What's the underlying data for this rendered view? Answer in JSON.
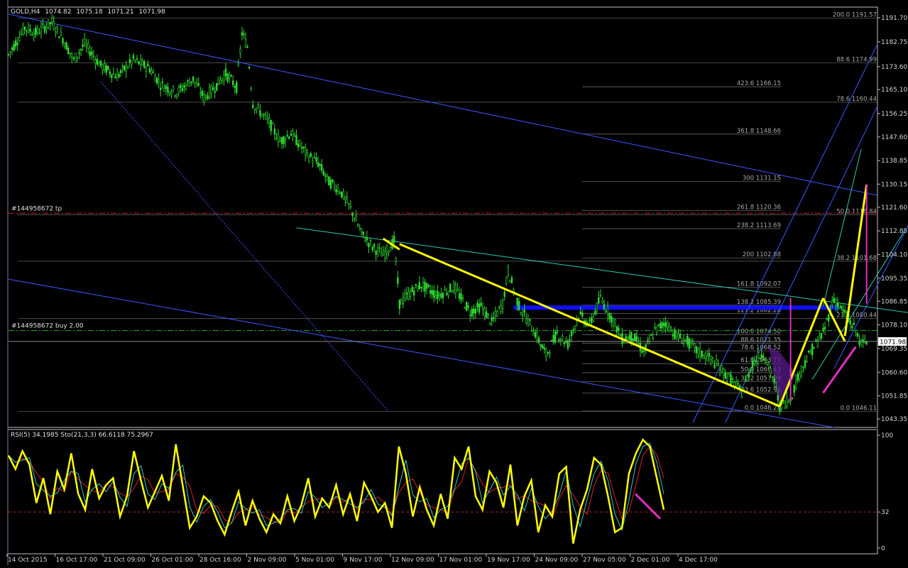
{
  "chart_data": {
    "type": "candlestick",
    "title": "GOLD,H4",
    "ohlc": {
      "open": "1074.82",
      "high": "1075.18",
      "low": "1071.21",
      "close": "1071.98"
    },
    "current_price": "1071.98",
    "price_axis": {
      "ylim": [
        1040.2,
        1195.6
      ],
      "ticks": [
        "1191.70",
        "1182.75",
        "1173.60",
        "1165.10",
        "1156.25",
        "1147.60",
        "1138.85",
        "1130.15",
        "1121.60",
        "1112.85",
        "1104.10",
        "1095.35",
        "1086.85",
        "1078.10",
        "1069.35",
        "1060.60",
        "1051.85",
        "1043.35"
      ]
    },
    "time_axis": {
      "labels": [
        "14 Oct 2015",
        "16 Oct 17:00",
        "21 Oct 09:00",
        "26 Oct 01:00",
        "28 Oct 16:00",
        "2 Nov 09:00",
        "5 Nov 01:00",
        "9 Nov 17:00",
        "12 Nov 09:00",
        "17 Nov 01:00",
        "19 Nov 17:00",
        "24 Nov 09:00",
        "27 Nov 05:00",
        "2 Dec 01:00",
        "4 Dec 17:00"
      ]
    },
    "price_path": [
      [
        0,
        1178
      ],
      [
        3,
        1188
      ],
      [
        5,
        1186
      ],
      [
        8,
        1190
      ],
      [
        10,
        1184
      ],
      [
        12,
        1176
      ],
      [
        14,
        1182
      ],
      [
        17,
        1174
      ],
      [
        20,
        1170
      ],
      [
        23,
        1176
      ],
      [
        26,
        1173
      ],
      [
        28,
        1167
      ],
      [
        31,
        1164
      ],
      [
        34,
        1169
      ],
      [
        36,
        1162
      ],
      [
        38,
        1166
      ],
      [
        40,
        1171
      ],
      [
        42,
        1166
      ],
      [
        43,
        1186
      ],
      [
        44,
        1181
      ],
      [
        45,
        1160
      ],
      [
        48,
        1153
      ],
      [
        50,
        1146
      ],
      [
        52,
        1149
      ],
      [
        55,
        1141
      ],
      [
        57,
        1138
      ],
      [
        59,
        1131
      ],
      [
        61,
        1128
      ],
      [
        63,
        1121
      ],
      [
        65,
        1112
      ],
      [
        67,
        1107
      ],
      [
        69,
        1104
      ],
      [
        71,
        1109
      ],
      [
        72,
        1086
      ],
      [
        74,
        1090
      ],
      [
        76,
        1093
      ],
      [
        79,
        1089
      ],
      [
        82,
        1092
      ],
      [
        85,
        1083
      ],
      [
        87,
        1085
      ],
      [
        89,
        1079
      ],
      [
        91,
        1086
      ],
      [
        92,
        1098
      ],
      [
        94,
        1085
      ],
      [
        97,
        1075
      ],
      [
        99,
        1067
      ],
      [
        101,
        1075
      ],
      [
        103,
        1071
      ],
      [
        105,
        1082
      ],
      [
        107,
        1078
      ],
      [
        109,
        1088
      ],
      [
        111,
        1081
      ],
      [
        113,
        1073
      ],
      [
        115,
        1074
      ],
      [
        117,
        1068
      ],
      [
        119,
        1076
      ],
      [
        121,
        1079
      ],
      [
        123,
        1074
      ],
      [
        125,
        1072
      ],
      [
        127,
        1068
      ],
      [
        129,
        1066
      ],
      [
        131,
        1062
      ],
      [
        133,
        1058
      ],
      [
        135,
        1053
      ],
      [
        137,
        1064
      ],
      [
        139,
        1068
      ],
      [
        141,
        1057
      ],
      [
        142,
        1048
      ],
      [
        144,
        1051
      ],
      [
        146,
        1062
      ],
      [
        148,
        1069
      ],
      [
        150,
        1075
      ],
      [
        152,
        1088
      ],
      [
        154,
        1082
      ],
      [
        156,
        1076
      ],
      [
        157,
        1071
      ],
      [
        158,
        1072
      ]
    ],
    "horizontal_lines": [
      {
        "label": "#144958672 tp",
        "price": 1119.4,
        "color": "#d02020",
        "style": "dash-dot"
      },
      {
        "label": "#144958672 buy 2.00",
        "price": 1076.0,
        "color": "#20b020",
        "style": "dash-dot"
      }
    ],
    "support_zone": {
      "price": 1084.5,
      "color": "#1010ff"
    },
    "fibonacci_left": [
      {
        "level": "423.6",
        "price": "1166.15"
      },
      {
        "level": "361.8",
        "price": "1148.66"
      },
      {
        "level": "300",
        "price": "1131.15"
      },
      {
        "level": "261.8",
        "price": "1120.36"
      },
      {
        "level": "238.2",
        "price": "1113.69"
      },
      {
        "level": "200",
        "price": "1102.88"
      },
      {
        "level": "161.8",
        "price": "1092.07"
      },
      {
        "level": "138.2",
        "price": "1085.39"
      },
      {
        "level": "127.2",
        "price": "1082.28"
      },
      {
        "level": "100.0",
        "price": "1074.50"
      },
      {
        "level": "88.6",
        "price": "1071.35"
      },
      {
        "level": "78.6",
        "price": "1068.52"
      },
      {
        "level": "61.8",
        "price": "1063.77"
      },
      {
        "level": "50.0",
        "price": "1060.43"
      },
      {
        "level": "38.2",
        "price": "1057.09"
      },
      {
        "level": "23.6",
        "price": "1052.96"
      },
      {
        "level": "0.0",
        "price": "1046.28"
      }
    ],
    "fibonacci_right": [
      {
        "level": "200.0",
        "price": "1191.57"
      },
      {
        "level": "88.6",
        "price": "1174.99"
      },
      {
        "level": "78.6",
        "price": "1160.44"
      },
      {
        "level": "50.0",
        "price": "1118.84"
      },
      {
        "level": "38.2",
        "price": "1101.68"
      },
      {
        "level": "23.6",
        "price": "1080.44"
      },
      {
        "level": "0.0",
        "price": "1046.11"
      }
    ],
    "indicator": {
      "header": "RSI(5) 34.1985  Sto(21,3,3) 66.6118 75.2967",
      "ticks": [
        "100",
        "32",
        "0"
      ],
      "level_line": 32,
      "rsi_values": [
        82,
        70,
        86,
        74,
        40,
        62,
        30,
        68,
        52,
        84,
        48,
        34,
        70,
        44,
        56,
        62,
        28,
        46,
        86,
        60,
        36,
        50,
        64,
        42,
        92,
        55,
        18,
        28,
        46,
        40,
        24,
        12,
        32,
        50,
        20,
        42,
        26,
        14,
        30,
        22,
        46,
        24,
        38,
        62,
        28,
        44,
        36,
        56,
        30,
        48,
        24,
        58,
        46,
        32,
        40,
        18,
        90,
        66,
        28,
        54,
        34,
        20,
        48,
        26,
        80,
        70,
        90,
        46,
        34,
        68,
        58,
        36,
        74,
        20,
        46,
        60,
        14,
        38,
        28,
        66,
        72,
        4,
        34,
        52,
        80,
        74,
        46,
        14,
        18,
        66,
        84,
        96,
        90,
        62,
        34
      ]
    },
    "colors": {
      "price": "#2ed82e",
      "axis_line": "#c0c0c0",
      "grid": "#3a3a3a",
      "trend": "#ffff00",
      "pitchfork": "#3a58ff",
      "channel_cyan": "#30c8b0",
      "magenta": "#e030c0",
      "fib_line": "#666666",
      "rsi": "#ffff00",
      "sto_main": "#30c8c8",
      "sto_signal": "#e02020",
      "cloud": "#5a1a8a"
    }
  }
}
